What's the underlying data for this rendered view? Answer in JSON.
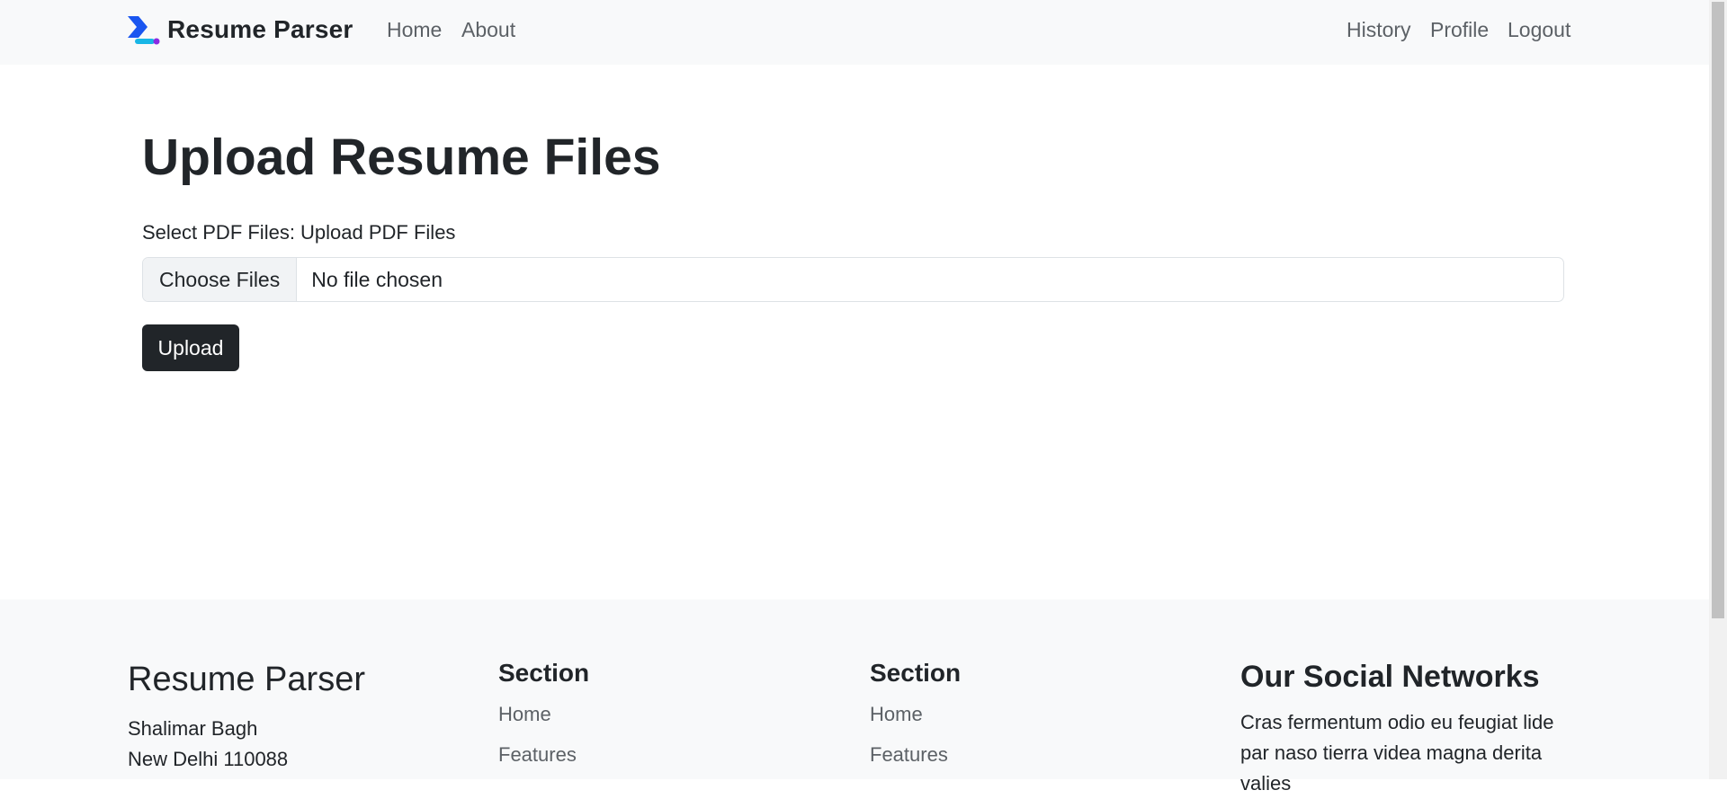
{
  "navbar": {
    "brand": "Resume Parser",
    "left_links": [
      "Home",
      "About"
    ],
    "right_links": [
      "History",
      "Profile",
      "Logout"
    ]
  },
  "main": {
    "title": "Upload Resume Files",
    "file_label": "Select PDF Files: Upload PDF Files",
    "choose_button": "Choose Files",
    "file_status": "No file chosen",
    "upload_button": "Upload"
  },
  "footer": {
    "brand": "Resume Parser",
    "address_line1": "Shalimar Bagh",
    "address_line2": "New Delhi 110088",
    "section1": {
      "heading": "Section",
      "links": [
        "Home",
        "Features"
      ]
    },
    "section2": {
      "heading": "Section",
      "links": [
        "Home",
        "Features"
      ]
    },
    "social": {
      "heading": "Our Social Networks",
      "text": "Cras fermentum odio eu feugiat lide par naso tierra videa magna derita valies"
    }
  },
  "colors": {
    "navbar_bg": "#f8f9fa",
    "upload_button_bg": "#212529",
    "logo_blue": "#1a56f0",
    "logo_purple": "#8a2be2"
  }
}
